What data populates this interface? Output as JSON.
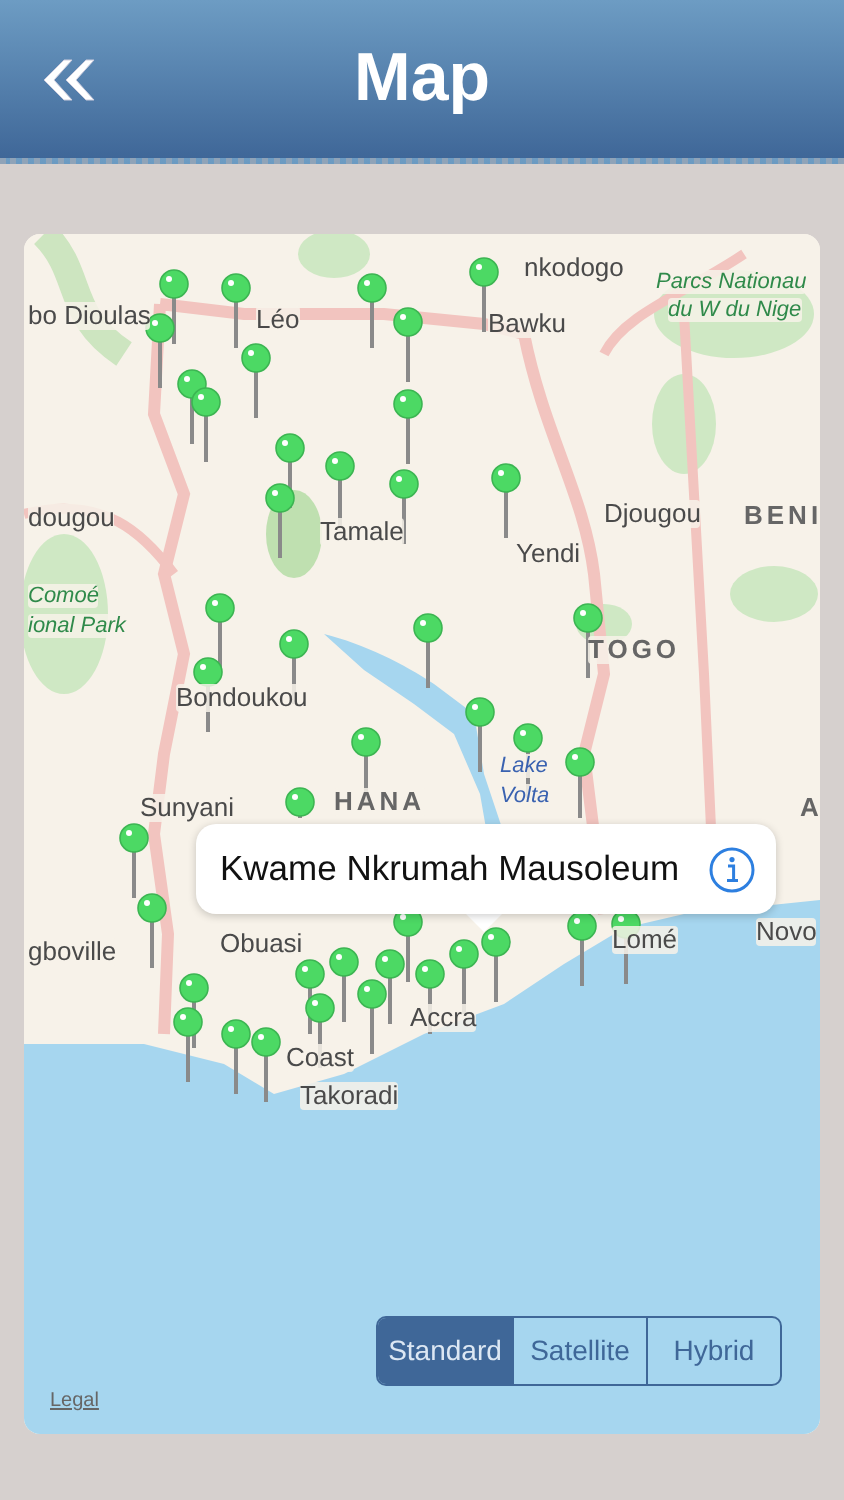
{
  "header": {
    "title": "Map"
  },
  "map": {
    "labels": [
      {
        "text": "bo Dioulas",
        "kind": "city"
      },
      {
        "text": "Léo",
        "kind": "city"
      },
      {
        "text": "nkodogo",
        "kind": "city"
      },
      {
        "text": "Bawku",
        "kind": "city"
      },
      {
        "text": "Parcs Nationau",
        "kind": "park"
      },
      {
        "text": "du W du Nige",
        "kind": "park"
      },
      {
        "text": "dougou",
        "kind": "city"
      },
      {
        "text": "Djougou",
        "kind": "city"
      },
      {
        "text": "BENI",
        "kind": "country"
      },
      {
        "text": "Tamale",
        "kind": "city"
      },
      {
        "text": "Yendi",
        "kind": "city"
      },
      {
        "text": "Comoé",
        "kind": "park"
      },
      {
        "text": "ional Park",
        "kind": "park"
      },
      {
        "text": "TOGO",
        "kind": "country"
      },
      {
        "text": "Bondoukou",
        "kind": "city"
      },
      {
        "text": "Sunyani",
        "kind": "city"
      },
      {
        "text": "HANA",
        "kind": "country"
      },
      {
        "text": "Lake",
        "kind": "water"
      },
      {
        "text": "Volta",
        "kind": "water"
      },
      {
        "text": "A",
        "kind": "country"
      },
      {
        "text": "Obuasi",
        "kind": "city"
      },
      {
        "text": "gboville",
        "kind": "city"
      },
      {
        "text": "Lomé",
        "kind": "city"
      },
      {
        "text": "Novo",
        "kind": "city"
      },
      {
        "text": "Accra",
        "kind": "city"
      },
      {
        "text": "Coast",
        "kind": "city"
      },
      {
        "text": "Takoradi",
        "kind": "city"
      }
    ],
    "callout": {
      "title": "Kwame Nkrumah Mausoleum"
    },
    "legal": "Legal",
    "map_types": [
      {
        "label": "Standard",
        "selected": true
      },
      {
        "label": "Satellite",
        "selected": false
      },
      {
        "label": "Hybrid",
        "selected": false
      }
    ]
  }
}
